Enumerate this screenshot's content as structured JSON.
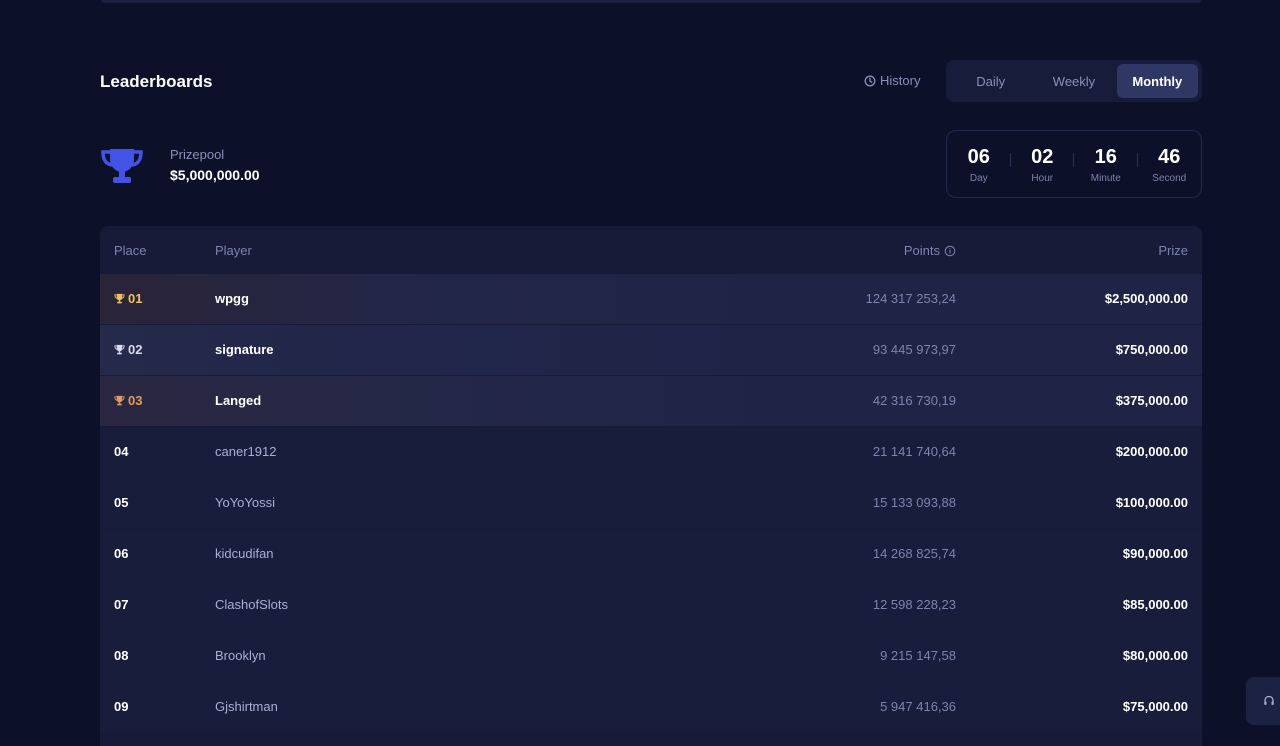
{
  "header": {
    "title": "Leaderboards",
    "history_label": "History",
    "tabs": [
      {
        "label": "Daily",
        "active": false
      },
      {
        "label": "Weekly",
        "active": false
      },
      {
        "label": "Monthly",
        "active": true
      }
    ]
  },
  "prizepool": {
    "label": "Prizepool",
    "value": "$5,000,000.00"
  },
  "countdown": [
    {
      "value": "06",
      "unit": "Day"
    },
    {
      "value": "02",
      "unit": "Hour"
    },
    {
      "value": "16",
      "unit": "Minute"
    },
    {
      "value": "46",
      "unit": "Second"
    }
  ],
  "table": {
    "columns": {
      "place": "Place",
      "player": "Player",
      "points": "Points",
      "prize": "Prize"
    },
    "rows": [
      {
        "place": "01",
        "player": "wpgg",
        "points": "124 317 253,24",
        "prize": "$2,500,000.00"
      },
      {
        "place": "02",
        "player": "signature",
        "points": "93 445 973,97",
        "prize": "$750,000.00"
      },
      {
        "place": "03",
        "player": "Langed",
        "points": "42 316 730,19",
        "prize": "$375,000.00"
      },
      {
        "place": "04",
        "player": "caner1912",
        "points": "21 141 740,64",
        "prize": "$200,000.00"
      },
      {
        "place": "05",
        "player": "YoYoYossi",
        "points": "15 133 093,88",
        "prize": "$100,000.00"
      },
      {
        "place": "06",
        "player": "kidcudifan",
        "points": "14 268 825,74",
        "prize": "$90,000.00"
      },
      {
        "place": "07",
        "player": "ClashofSlots",
        "points": "12 598 228,23",
        "prize": "$85,000.00"
      },
      {
        "place": "08",
        "player": "Brooklyn",
        "points": "9 215 147,58",
        "prize": "$80,000.00"
      },
      {
        "place": "09",
        "player": "Gjshirtman",
        "points": "5 947 416,36",
        "prize": "$75,000.00"
      }
    ]
  },
  "icons": {
    "history": "clock-icon",
    "trophy": "trophy-icon",
    "info": "info-icon",
    "support": "headset-icon"
  },
  "colors": {
    "background": "#0c1029",
    "accent": "#4353e8",
    "gold": "#f2c14e",
    "silver": "#d9dbe8",
    "bronze": "#e39a5c"
  }
}
